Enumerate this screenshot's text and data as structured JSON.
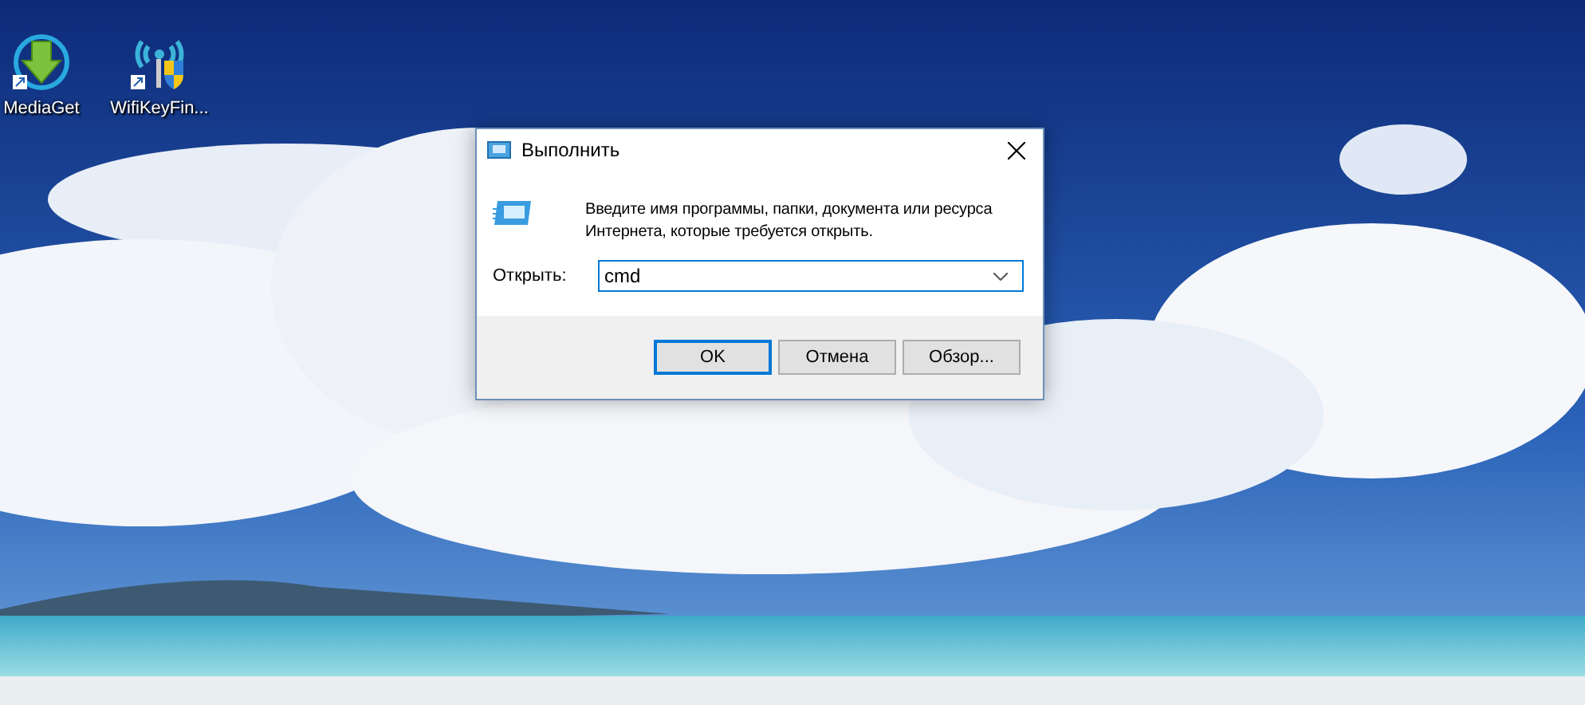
{
  "desktop": {
    "icons": [
      {
        "label": "MediaGet",
        "kind": "download",
        "shortcut": true
      },
      {
        "label": "WifiKeyFin...",
        "kind": "wifi",
        "shortcut": true
      }
    ]
  },
  "dialog": {
    "title": "Выполнить",
    "message": "Введите имя программы, папки, документа или ресурса Интернета, которые требуется открыть.",
    "open_label": "Открыть:",
    "command": {
      "value": "cmd"
    },
    "buttons": [
      {
        "label": "OK",
        "default": true
      },
      {
        "label": "Отмена",
        "default": false
      },
      {
        "label": "Обзор...",
        "default": false
      }
    ]
  }
}
